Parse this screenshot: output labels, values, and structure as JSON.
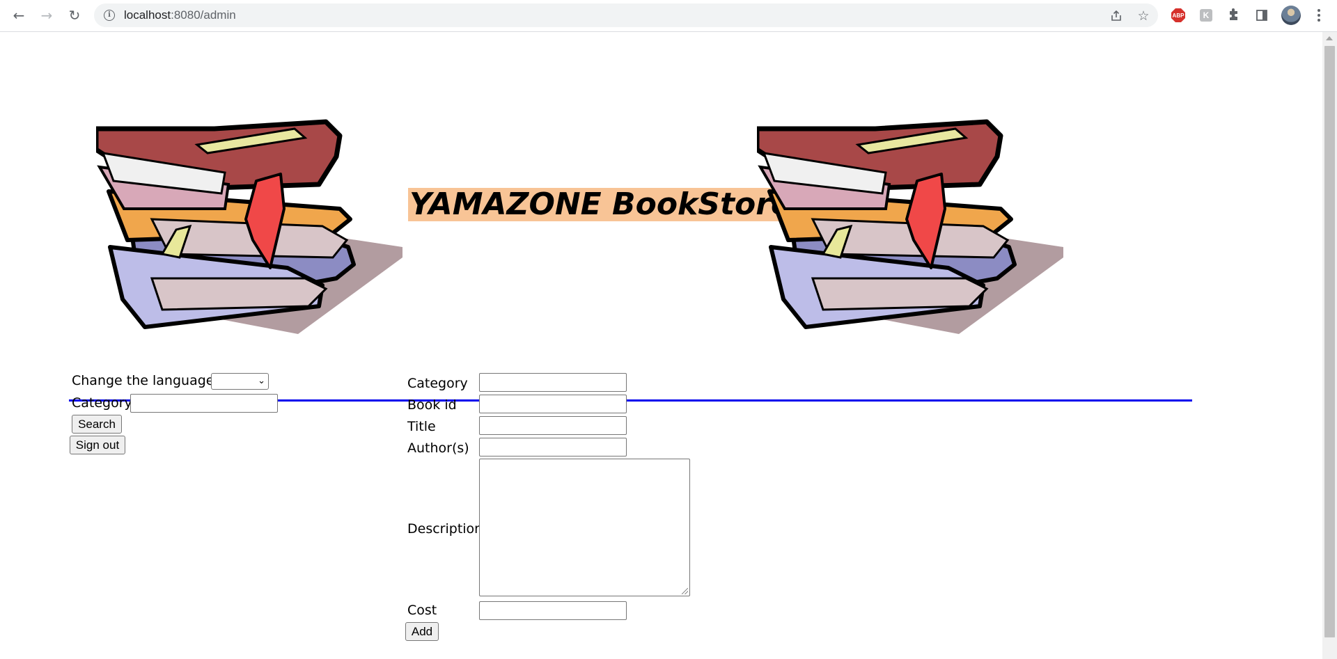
{
  "browser": {
    "url_host": "localhost",
    "url_path": ":8080/admin"
  },
  "header": {
    "title": "YAMAZONE BookStore"
  },
  "sidebar": {
    "language_label": "Change the language:",
    "language_value": "",
    "category_label": "Category",
    "category_value": "",
    "search_button": "Search",
    "signout_button": "Sign out"
  },
  "form": {
    "category_label": "Category",
    "bookid_label": "Book id",
    "title_label": "Title",
    "authors_label": "Author(s)",
    "description_label": "Description",
    "cost_label": "Cost",
    "add_button": "Add",
    "category_value": "",
    "bookid_value": "",
    "title_value": "",
    "authors_value": "",
    "description_value": "",
    "cost_value": ""
  },
  "colors": {
    "title_highlight": "#f8c496",
    "divider": "#0000ee"
  }
}
